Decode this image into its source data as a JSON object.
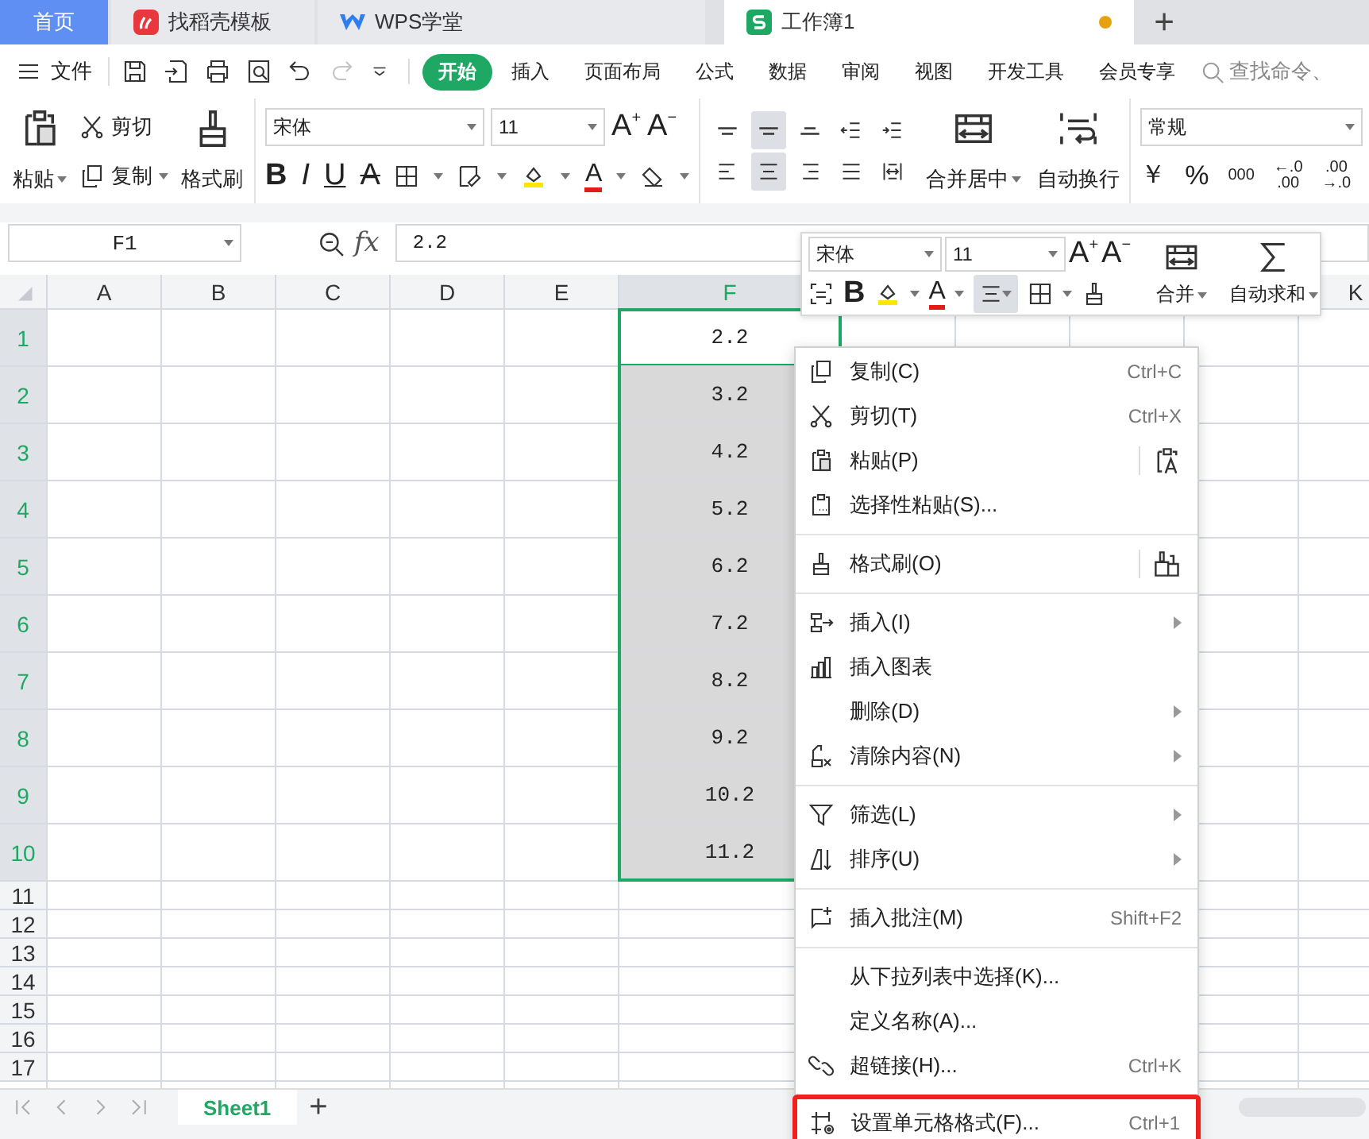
{
  "tabs": [
    {
      "label": "首页",
      "kind": "home",
      "selected": false,
      "modified": false
    },
    {
      "label": "找稻壳模板",
      "kind": "docer",
      "selected": false,
      "modified": false
    },
    {
      "label": "WPS学堂",
      "kind": "school",
      "selected": false,
      "modified": false
    },
    {
      "label": "工作簿1",
      "kind": "sheet",
      "selected": true,
      "modified": true
    }
  ],
  "new_tab": "+",
  "menu_bar": {
    "file": "文件",
    "redo_disabled": true,
    "tabs": [
      {
        "label": "开始",
        "selected": true
      },
      {
        "label": "插入",
        "selected": false
      },
      {
        "label": "页面布局",
        "selected": false
      },
      {
        "label": "公式",
        "selected": false
      },
      {
        "label": "数据",
        "selected": false
      },
      {
        "label": "审阅",
        "selected": false
      },
      {
        "label": "视图",
        "selected": false
      },
      {
        "label": "开发工具",
        "selected": false
      },
      {
        "label": "会员专享",
        "selected": false
      }
    ],
    "search": {
      "placeholder": "查找命令、"
    }
  },
  "ribbon": {
    "paste": "粘贴",
    "cut": "剪切",
    "copy": "复制",
    "format_painter": "格式刷",
    "font": "宋体",
    "size": "11",
    "grow": {
      "letter": "A",
      "sign": "+"
    },
    "shrink": {
      "letter": "A",
      "sign": "−"
    },
    "styles": [
      {
        "kind": "bold",
        "label": "B"
      },
      {
        "kind": "italic",
        "label": "I"
      },
      {
        "kind": "underline",
        "label": "U"
      },
      {
        "kind": "strike",
        "label": "A"
      }
    ],
    "font_color": "A",
    "align_buttons": [
      {
        "selected": false
      },
      {
        "selected": true
      },
      {
        "selected": false
      },
      {
        "selected": false
      },
      {
        "selected": false
      },
      {
        "selected": false
      },
      {
        "selected": true
      },
      {
        "selected": false
      },
      {
        "selected": false
      },
      {
        "selected": false
      }
    ],
    "merge": "合并居中",
    "wrap": "自动换行",
    "number_format": "常规",
    "currency": "￥",
    "percent": "%",
    "thousands": "000",
    "inc_decimal": [
      "←.0",
      ".00"
    ],
    "dec_decimal": [
      ".00",
      "→.0"
    ]
  },
  "formula_bar": {
    "name_box": "F1",
    "fx": "fx",
    "value": "2.2"
  },
  "sheet": {
    "columns": [
      {
        "label": "A",
        "selected": false
      },
      {
        "label": "B",
        "selected": false
      },
      {
        "label": "C",
        "selected": false
      },
      {
        "label": "D",
        "selected": false
      },
      {
        "label": "E",
        "selected": false
      },
      {
        "label": "F",
        "selected": true
      },
      {
        "label": "K",
        "selected": false
      }
    ],
    "rows": [
      {
        "label": "1",
        "selected": true,
        "active": true,
        "value": "2.2"
      },
      {
        "label": "2",
        "selected": true,
        "active": false,
        "value": "3.2"
      },
      {
        "label": "3",
        "selected": true,
        "active": false,
        "value": "4.2"
      },
      {
        "label": "4",
        "selected": true,
        "active": false,
        "value": "5.2"
      },
      {
        "label": "5",
        "selected": true,
        "active": false,
        "value": "6.2"
      },
      {
        "label": "6",
        "selected": true,
        "active": false,
        "value": "7.2"
      },
      {
        "label": "7",
        "selected": true,
        "active": false,
        "value": "8.2"
      },
      {
        "label": "8",
        "selected": true,
        "active": false,
        "value": "9.2"
      },
      {
        "label": "9",
        "selected": true,
        "active": false,
        "value": "10.2"
      },
      {
        "label": "10",
        "selected": true,
        "active": false,
        "value": "11.2"
      },
      {
        "label": "11",
        "selected": false,
        "active": false
      },
      {
        "label": "12",
        "selected": false,
        "active": false
      },
      {
        "label": "13",
        "selected": false,
        "active": false
      },
      {
        "label": "14",
        "selected": false,
        "active": false
      },
      {
        "label": "15",
        "selected": false,
        "active": false
      },
      {
        "label": "16",
        "selected": false,
        "active": false
      },
      {
        "label": "17",
        "selected": false,
        "active": false
      }
    ]
  },
  "sheet_tabs": [
    {
      "label": "Sheet1",
      "selected": true
    }
  ],
  "add_sheet": "+",
  "mini_toolbar": {
    "font": "宋体",
    "size": "11",
    "grow": {
      "letter": "A",
      "sign": "+"
    },
    "shrink": {
      "letter": "A",
      "sign": "−"
    },
    "bold": "B",
    "font_color": "A",
    "merge": "合并",
    "autosum": "自动求和",
    "align_selected": true
  },
  "context_menu": {
    "groups": [
      [
        {
          "label": "复制(C)",
          "shortcut": "Ctrl+C",
          "submenu": false,
          "extra": false,
          "boxed": false
        },
        {
          "label": "剪切(T)",
          "shortcut": "Ctrl+X",
          "submenu": false,
          "extra": false,
          "boxed": false
        },
        {
          "label": "粘贴(P)",
          "submenu": false,
          "extra": true,
          "boxed": false
        },
        {
          "label": "选择性粘贴(S)...",
          "submenu": false,
          "extra": false,
          "boxed": false
        }
      ],
      [
        {
          "label": "格式刷(O)",
          "submenu": false,
          "extra": true,
          "boxed": false
        }
      ],
      [
        {
          "label": "插入(I)",
          "submenu": true,
          "extra": false,
          "boxed": false
        },
        {
          "label": "插入图表",
          "submenu": false,
          "extra": false,
          "boxed": false
        },
        {
          "label": "删除(D)",
          "submenu": true,
          "extra": false,
          "boxed": false
        },
        {
          "label": "清除内容(N)",
          "submenu": true,
          "extra": false,
          "boxed": false
        }
      ],
      [
        {
          "label": "筛选(L)",
          "submenu": true,
          "extra": false,
          "boxed": false
        },
        {
          "label": "排序(U)",
          "submenu": true,
          "extra": false,
          "boxed": false
        }
      ],
      [
        {
          "label": "插入批注(M)",
          "shortcut": "Shift+F2",
          "submenu": false,
          "extra": false,
          "boxed": false
        }
      ],
      [
        {
          "label": "从下拉列表中选择(K)...",
          "submenu": false,
          "extra": false,
          "boxed": false
        },
        {
          "label": "定义名称(A)...",
          "submenu": false,
          "extra": false,
          "boxed": false
        },
        {
          "label": "超链接(H)...",
          "shortcut": "Ctrl+K",
          "submenu": false,
          "extra": false,
          "boxed": false
        },
        {
          "label": "设置单元格格式(F)...",
          "shortcut": "Ctrl+1",
          "submenu": false,
          "extra": false,
          "boxed": true
        }
      ]
    ]
  }
}
